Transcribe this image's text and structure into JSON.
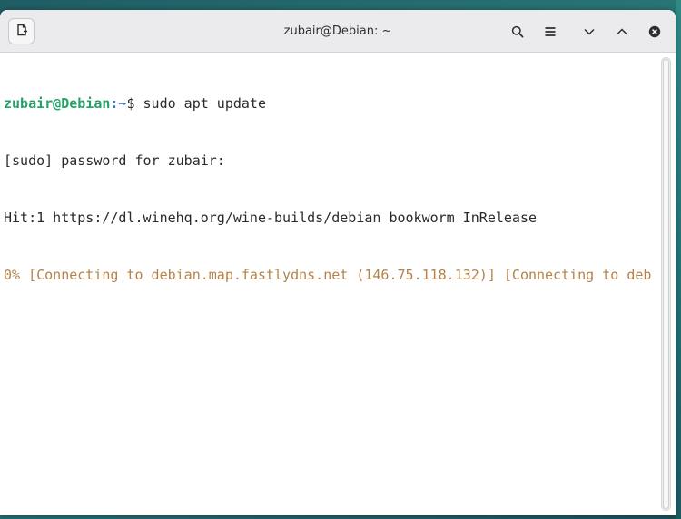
{
  "window": {
    "title": "zubair@Debian: ~"
  },
  "headerbar": {
    "icons": {
      "new_tab": "new-tab-icon",
      "search": "search-icon",
      "menu": "hamburger-menu-icon",
      "minimize": "chevron-down-icon",
      "maximize": "chevron-up-icon",
      "close": "close-icon"
    }
  },
  "terminal": {
    "prompt_user_host": "zubair@Debian",
    "prompt_path": ":~",
    "prompt_symbol": "$ ",
    "command": "sudo apt update",
    "lines": [
      "[sudo] password for zubair:",
      "Hit:1 https://dl.winehq.org/wine-builds/debian bookworm InRelease"
    ],
    "progress_line": "0% [Connecting to debian.map.fastlydns.net (146.75.118.132)] [Connecting to deb"
  },
  "colors": {
    "prompt_user": "#26a269",
    "prompt_path": "#3a75c4",
    "progress": "#b5834a",
    "background": "#ffffff",
    "headerbar": "#ebebed"
  }
}
